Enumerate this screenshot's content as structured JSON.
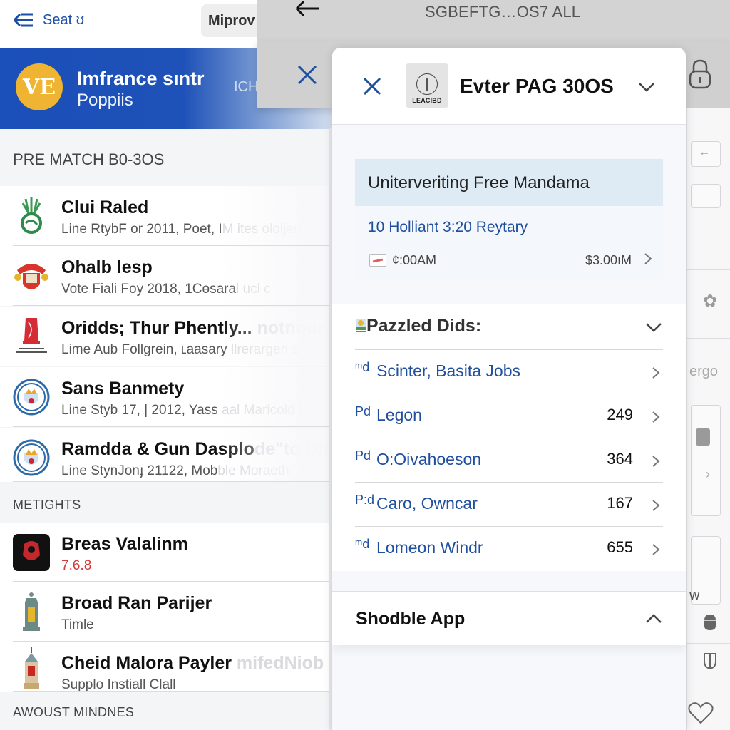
{
  "left_app": {
    "topbar": {
      "back_label": "Seat ʊ",
      "improve_button": "Miprov"
    },
    "banner": {
      "logo_text": "VE",
      "title": "Imfrance sıntr",
      "subtitle": "Poppiis",
      "ghost_text": "ICH"
    },
    "sections": [
      {
        "title": "PRE MATCH Β0-3OS",
        "items": [
          {
            "icon": "green-crest-icon",
            "title": "Clui Raled",
            "subtitle": "Line RtybF or 2011, Poet, I",
            "subtitle_faded": "M ites ololjen"
          },
          {
            "icon": "red-gold-crest-icon",
            "title": "Ohalb lesp",
            "subtitle": "Vote Fiali Foy 2018, 1Cɵsara",
            "subtitle_faded": "l ucl c"
          },
          {
            "icon": "red-tower-crest-icon",
            "title": "Oridds; Thur Phently...",
            "title_faded": " notnour",
            "subtitle": "Lime Aub Follgrein, ʟaasary",
            "subtitle_faded": " llrerargen s"
          },
          {
            "icon": "blue-round-crest-icon",
            "title": "Sans Banmety",
            "subtitle": "Line Styb 17, | 2012, Yass",
            "subtitle_faded": " aal Maricold l..."
          },
          {
            "icon": "blue-round-crest-icon",
            "title": "Ramdda & Gun Dasplo",
            "title_faded": "de\"to Dir",
            "subtitle": "Line StynJonɟ 21122, Mob",
            "subtitle_faded": "ble Moraeth"
          }
        ]
      },
      {
        "title": "METIGHTS",
        "items": [
          {
            "icon": "black-red-app-icon",
            "title": "Breas Valalinm",
            "subtitle": "7.6.8",
            "subtitle_color": "#d23a3a"
          },
          {
            "icon": "lantern-tower-icon",
            "title": "Broad Ran Parijer",
            "subtitle": "Timle"
          },
          {
            "icon": "church-tower-icon",
            "title": "Cheid Malora Payler",
            "title_faded": " mifedNiob",
            "subtitle": "Supplo Instiall Clall"
          }
        ]
      },
      {
        "title": "AWOUST MINDNES",
        "items": []
      }
    ]
  },
  "gray_overlay": {
    "title": "SGBEFTG…OS7 ALL"
  },
  "modal": {
    "logo_label": "LEACIBD",
    "title": "Evter PAG 30OS",
    "event": {
      "title": "Uniterveriting Free Mandama",
      "line": "10 Holliant 3:20 Reytary",
      "time": "¢:00AM",
      "price": "$3.00ıM"
    },
    "list": {
      "title": "Pazzled Dids:",
      "items": [
        {
          "prefix": "ᵐd",
          "label": "Scinter, Basita Jobs",
          "count": ""
        },
        {
          "prefix": "Pd",
          "label": "Legon",
          "count": "249"
        },
        {
          "prefix": "Pd",
          "label": "O:Oivahoeson",
          "count": "364"
        },
        {
          "prefix": "P:d",
          "label": "Caro, Owncar",
          "count": "167"
        },
        {
          "prefix": "ᵐd",
          "label": "Lomeon Windr",
          "count": "655"
        }
      ]
    },
    "app_section": {
      "title": "Shodble App"
    }
  },
  "right_strip": {
    "text_ergo": "ergo",
    "text_w": "w"
  },
  "colors": {
    "accent_blue": "#1f4f9e",
    "banner_blue": "#1b4fb9",
    "banner_logo": "#efb431",
    "version_red": "#d23a3a"
  }
}
